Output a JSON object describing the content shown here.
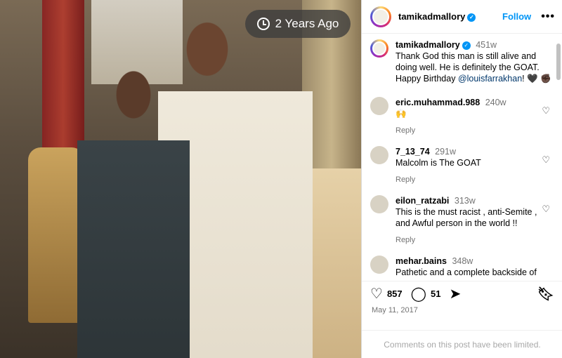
{
  "post": {
    "time_badge": "2 Years Ago",
    "username": "tamikadmallory",
    "follow_label": "Follow",
    "more_label": "•••"
  },
  "caption": {
    "username": "tamikadmallory",
    "time": "451w",
    "text": "Thank God this man is still alive and doing well. He is definitely the GOAT. Happy Birthday ",
    "mention": "@louisfarrakhan",
    "emoji": "! 🖤 ✊🏿"
  },
  "comments": [
    {
      "username": "eric.muhammad.988",
      "time": "240w",
      "text": "🙌",
      "reply": "Reply"
    },
    {
      "username": "7_13_74",
      "time": "291w",
      "text": "Malcolm is The GOAT",
      "reply": "Reply"
    },
    {
      "username": "eilon_ratzabi",
      "time": "313w",
      "text": "This is the must racist , anti-Semite , and Awful person in the world !!",
      "reply": "Reply"
    },
    {
      "username": "mehar.bains",
      "time": "348w",
      "text": "Pathetic and a complete backside of",
      "reply": ""
    }
  ],
  "actions": {
    "likes": "857",
    "comments": "51"
  },
  "date": "May 11, 2017",
  "limited_notice": "Comments on this post have been limited.",
  "icons": {
    "like": "heart-icon",
    "comment": "speech-bubble-icon",
    "share": "paper-plane-icon",
    "save": "bookmark-icon",
    "time": "clock-icon"
  }
}
